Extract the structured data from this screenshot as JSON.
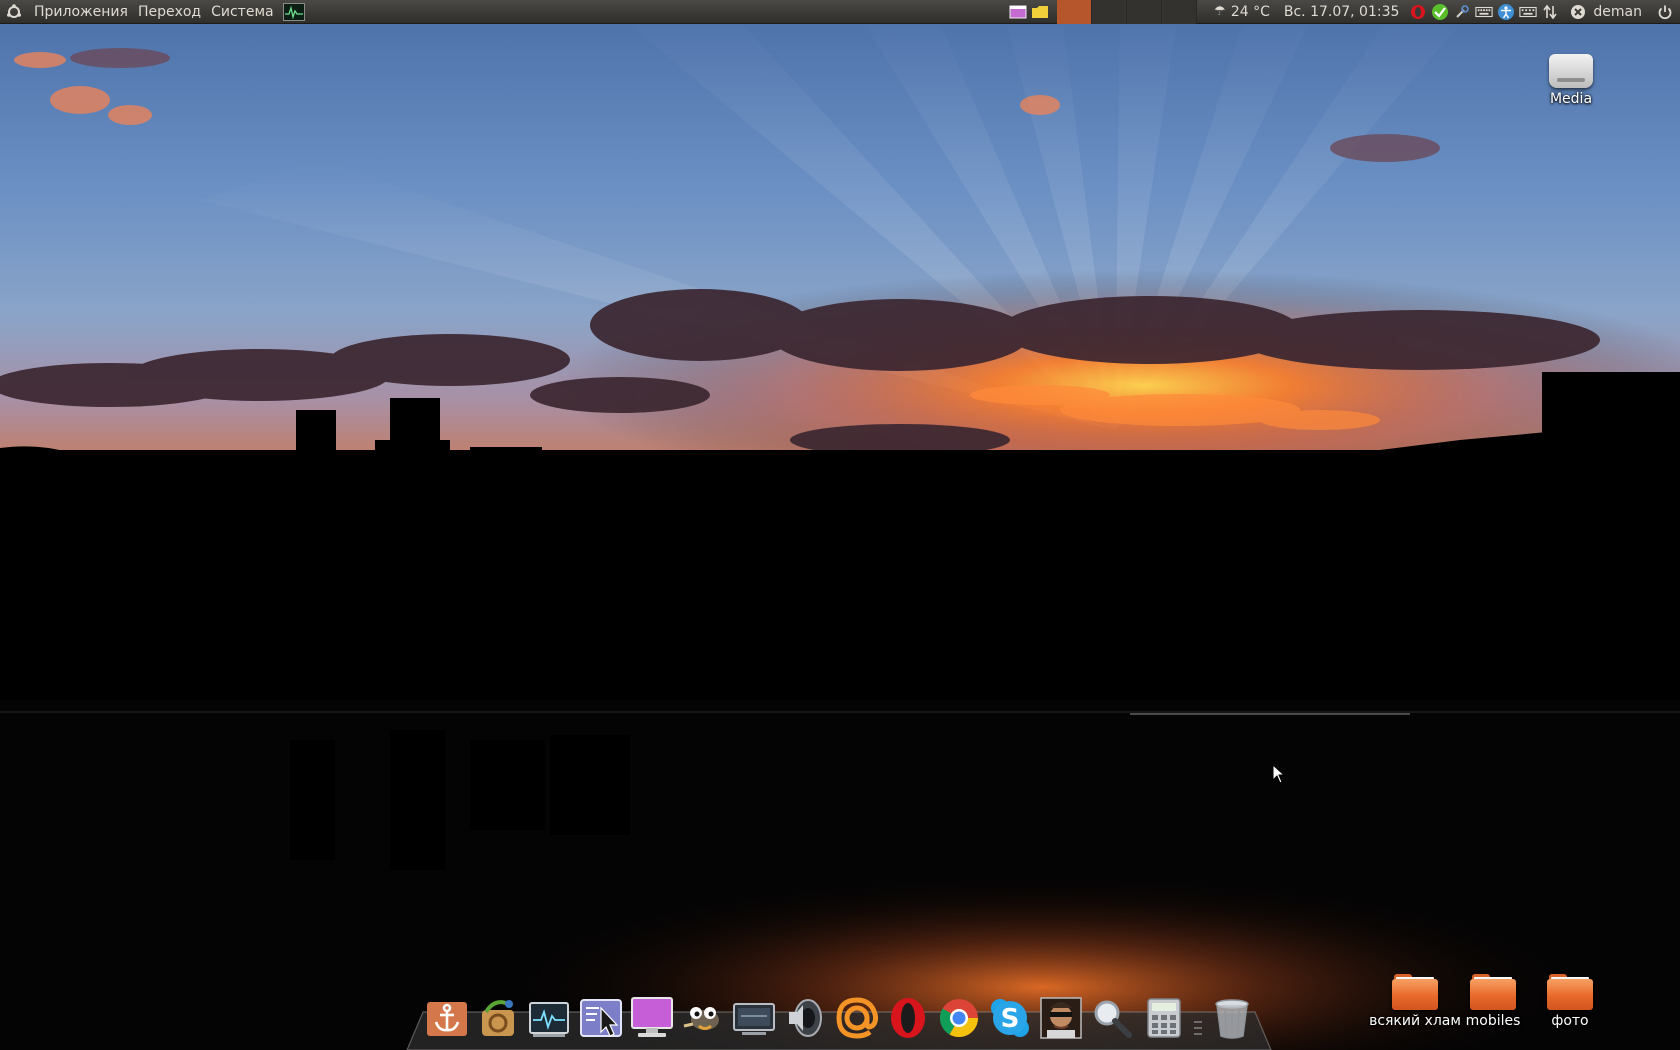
{
  "top_panel": {
    "menus": [
      "Приложения",
      "Переход",
      "Система"
    ],
    "weather": "24 °C",
    "clock": "Вс. 17.07, 01:35",
    "user": "deman"
  },
  "desktop": {
    "drive": {
      "label": "Media",
      "icon": "drive-icon"
    },
    "folders": [
      {
        "label": "всякий хлам",
        "icon": "folder-icon"
      },
      {
        "label": "mobiles",
        "icon": "folder-icon"
      },
      {
        "label": "фото",
        "icon": "folder-icon"
      }
    ]
  },
  "dock": {
    "items": [
      "anchor-icon",
      "ubuntu-tweak-icon",
      "system-monitor-icon",
      "window-picker-icon",
      "display-icon",
      "gimp-icon",
      "screenshot-icon",
      "speaker-icon",
      "mail-ru-agent-icon",
      "opera-icon",
      "chrome-icon",
      "skype-icon",
      "avatar-icon",
      "search-icon",
      "calculator-icon",
      "trash-icon"
    ]
  },
  "colors": {
    "panel_bg": "#3a3936",
    "panel_text": "#dfdbd2",
    "folder_orange": "#e8692b",
    "active_window_slot": "#b6562c"
  }
}
